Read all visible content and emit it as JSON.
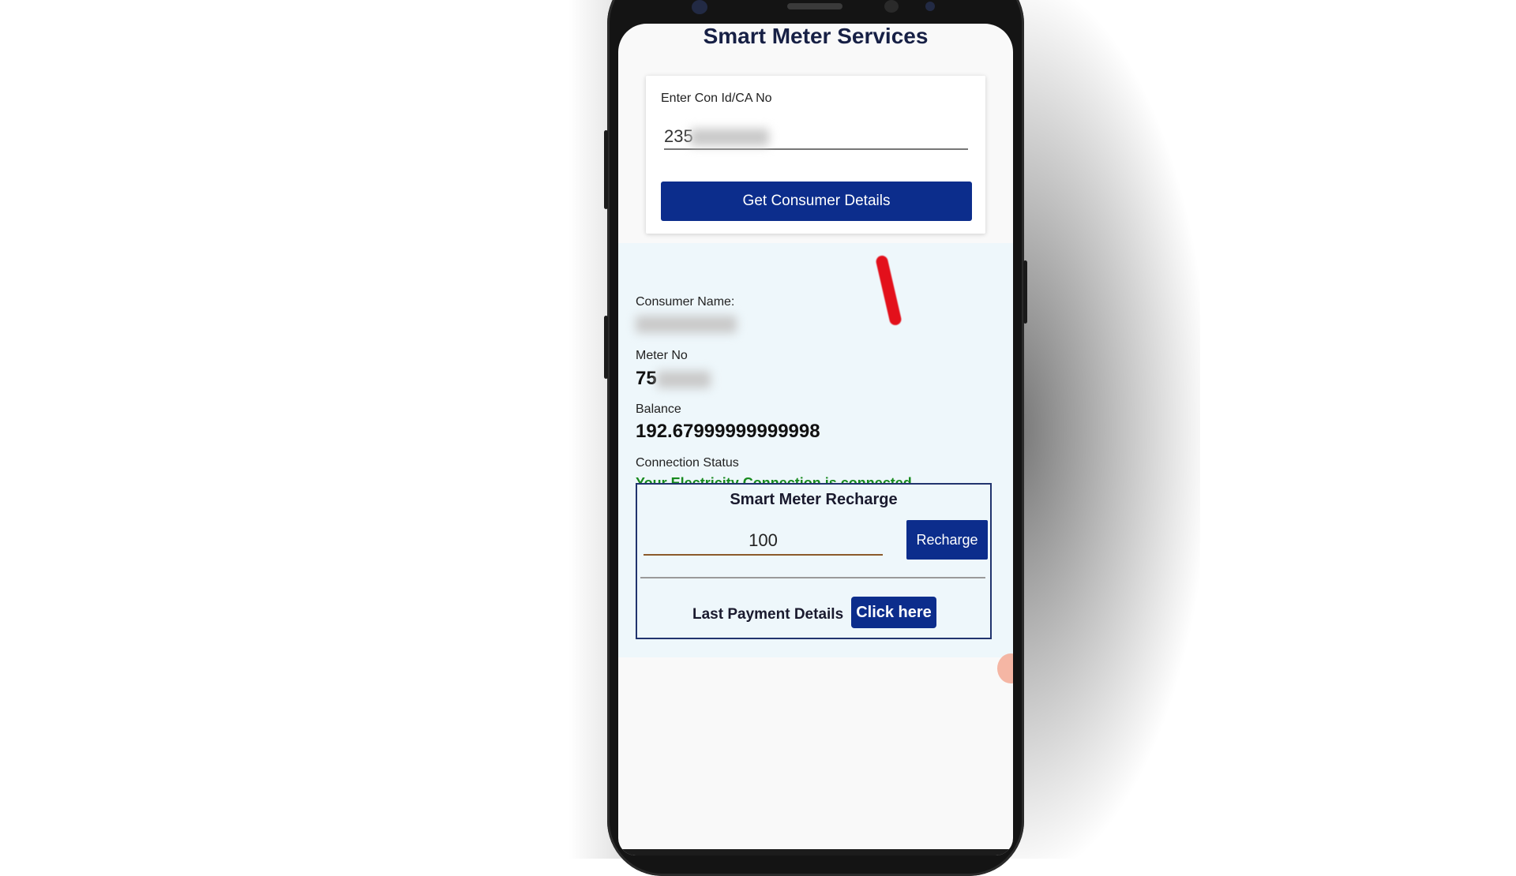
{
  "app": {
    "title": "Smart Meter Services"
  },
  "lookup": {
    "label": "Enter Con Id/CA No",
    "input_value": "235",
    "button_label": "Get Consumer Details"
  },
  "details": {
    "consumer_name_label": "Consumer Name:",
    "meter_no_label": "Meter No",
    "meter_no_value": "75",
    "balance_label": "Balance",
    "balance_value": "192.67999999999998",
    "connection_status_label": "Connection Status",
    "connection_status_value": "Your Electricity Connection is connected."
  },
  "recharge": {
    "title": "Smart Meter Recharge",
    "amount_value": "100",
    "button_label": "Recharge",
    "last_payment_label": "Last Payment Details",
    "click_here_label": "Click here"
  },
  "colors": {
    "primary": "#0c2d8c",
    "status_connected": "#178a1e",
    "title_text": "#172045",
    "details_background": "#eef7fb",
    "annotation_mark": "#e3101b"
  }
}
